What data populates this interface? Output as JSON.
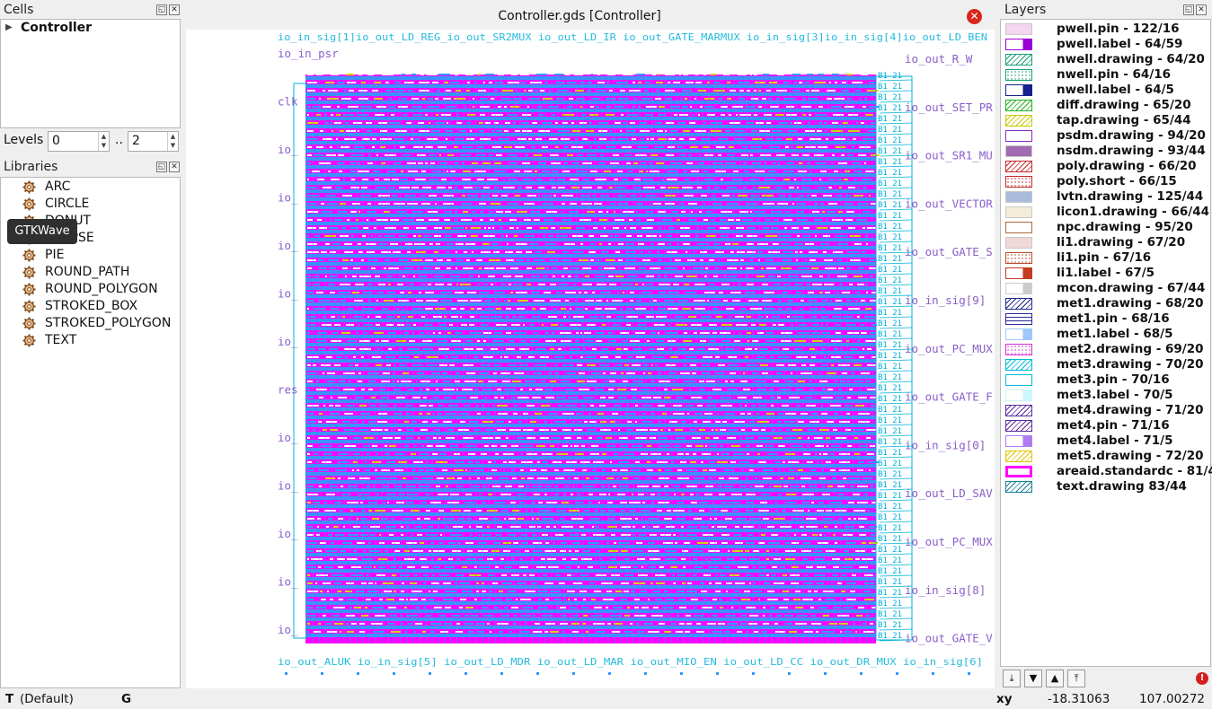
{
  "cells": {
    "title": "Cells",
    "items": [
      {
        "label": "Controller"
      }
    ]
  },
  "levels": {
    "label": "Levels",
    "from": "0",
    "separator": "..",
    "to": "2"
  },
  "libraries": {
    "title": "Libraries",
    "items": [
      {
        "label": "ARC"
      },
      {
        "label": "CIRCLE"
      },
      {
        "label": "DONUT"
      },
      {
        "label": "ELLIPSE"
      },
      {
        "label": "PIE"
      },
      {
        "label": "ROUND_PATH"
      },
      {
        "label": "ROUND_POLYGON"
      },
      {
        "label": "STROKED_BOX"
      },
      {
        "label": "STROKED_POLYGON"
      },
      {
        "label": "TEXT"
      }
    ]
  },
  "tooltip": "GTKWave",
  "view": {
    "title": "Controller.gds [Controller]",
    "left_labels": [
      "io_in_psr",
      "clk",
      "io_",
      "io_",
      "io_",
      "io_",
      "io_",
      "res",
      "io_",
      "io_",
      "io_",
      "io_",
      "io_"
    ],
    "right_labels": [
      "io_out_R_W",
      "io_out_SET_PR",
      "io_out_SR1_MU",
      "io_out_VECTOR",
      "io_out_GATE_S",
      "io_in_sig[9]",
      "io_out_PC_MUX",
      "io_out_GATE_F",
      "io_in_sig[0]",
      "io_out_LD_SAV",
      "io_out_PC_MUX",
      "io_in_sig[8]",
      "io_out_GATE_V"
    ],
    "top_text": "io_in_sig[1]io_out_LD_REG_io_out_SR2MUX io_out_LD_IR io_out_GATE_MARMUX io_in_sig[3]io_in_sig[4]io_out_LD_BEN",
    "bottom_text": "io_out_ALUK io_in_sig[5] io_out_LD_MDR io_out_LD_MAR io_out_MIO_EN io_out_LD_CC io_out_DR_MUX io_in_sig[6]",
    "colors": {
      "magenta": "#ff00ff",
      "blue": "#3399ff",
      "label": "#8a5fc9",
      "cyan": "#00b0d8",
      "yellow": "#d8d800"
    }
  },
  "layers": {
    "title": "Layers",
    "items": [
      {
        "label": "pwell.pin - 122/16",
        "color": "#f6d5ef",
        "style": "light"
      },
      {
        "label": "pwell.label - 64/59",
        "color": "#9b00d6",
        "style": "halfsolid"
      },
      {
        "label": "nwell.drawing - 64/20",
        "color": "#1a9e78",
        "style": "hatch"
      },
      {
        "label": "nwell.pin - 64/16",
        "color": "#1a9e78",
        "style": "dots"
      },
      {
        "label": "nwell.label - 64/5",
        "color": "#17208c",
        "style": "halfsolid"
      },
      {
        "label": "diff.drawing - 65/20",
        "color": "#22b022",
        "style": "hatch"
      },
      {
        "label": "tap.drawing - 65/44",
        "color": "#c8c800",
        "style": "hatch"
      },
      {
        "label": "psdm.drawing - 94/20",
        "color": "#8a2cbf",
        "style": "outline"
      },
      {
        "label": "nsdm.drawing - 93/44",
        "color": "#a06bb0",
        "style": "light"
      },
      {
        "label": "poly.drawing - 66/20",
        "color": "#c62828",
        "style": "hatch"
      },
      {
        "label": "poly.short - 66/15",
        "color": "#c62828",
        "style": "dots"
      },
      {
        "label": "lvtn.drawing - 125/44",
        "color": "#a9bcdc",
        "style": "light"
      },
      {
        "label": "licon1.drawing - 66/44",
        "color": "#f4ecd8",
        "style": "light"
      },
      {
        "label": "npc.drawing - 95/20",
        "color": "#b06a3a",
        "style": "outline"
      },
      {
        "label": "li1.drawing - 67/20",
        "color": "#f1d8d8",
        "style": "light"
      },
      {
        "label": "li1.pin - 67/16",
        "color": "#b54a2a",
        "style": "dots"
      },
      {
        "label": "li1.label - 67/5",
        "color": "#c23b22",
        "style": "halfsolid"
      },
      {
        "label": "mcon.drawing - 67/44",
        "color": "#cccccc",
        "style": "halfsolid"
      },
      {
        "label": "met1.drawing - 68/20",
        "color": "#1c2a8c",
        "style": "hatch"
      },
      {
        "label": "met1.pin - 68/16",
        "color": "#2a2a9c",
        "style": "grid"
      },
      {
        "label": "met1.label - 68/5",
        "color": "#9ec6ff",
        "style": "halfsolid"
      },
      {
        "label": "met2.drawing - 69/20",
        "color": "#d02fd0",
        "style": "dots"
      },
      {
        "label": "met3.drawing - 70/20",
        "color": "#00bcd4",
        "style": "hatch"
      },
      {
        "label": "met3.pin - 70/16",
        "color": "#00bcd4",
        "style": "outline"
      },
      {
        "label": "met3.label - 70/5",
        "color": "#ccf6fb",
        "style": "halfsolid"
      },
      {
        "label": "met4.drawing - 71/20",
        "color": "#5a2a9a",
        "style": "hatch"
      },
      {
        "label": "met4.pin - 71/16",
        "color": "#5a2a9a",
        "style": "hatch"
      },
      {
        "label": "met4.label - 71/5",
        "color": "#b07bf0",
        "style": "halfsolid"
      },
      {
        "label": "met5.drawing - 72/20",
        "color": "#e0c400",
        "style": "hatch"
      },
      {
        "label": "areaid.standardc - 81/4",
        "color": "#ff00ff",
        "style": "thick"
      },
      {
        "label": "text.drawing 83/44",
        "color": "#1a7e9a",
        "style": "hatch"
      }
    ]
  },
  "status": {
    "mode": "T",
    "mode_detail": "(Default)",
    "grid": "G",
    "coord_label": "xy",
    "x": "-18.31063",
    "y": "107.00272"
  }
}
